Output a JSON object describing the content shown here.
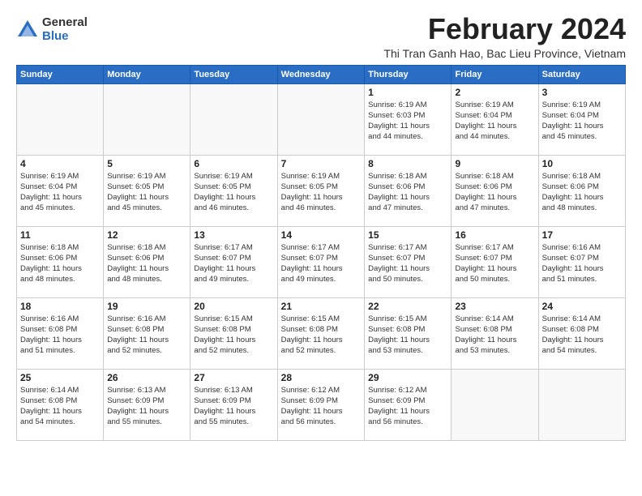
{
  "logo": {
    "general": "General",
    "blue": "Blue"
  },
  "title": "February 2024",
  "subtitle": "Thi Tran Ganh Hao, Bac Lieu Province, Vietnam",
  "headers": [
    "Sunday",
    "Monday",
    "Tuesday",
    "Wednesday",
    "Thursday",
    "Friday",
    "Saturday"
  ],
  "weeks": [
    [
      {
        "day": "",
        "info": ""
      },
      {
        "day": "",
        "info": ""
      },
      {
        "day": "",
        "info": ""
      },
      {
        "day": "",
        "info": ""
      },
      {
        "day": "1",
        "info": "Sunrise: 6:19 AM\nSunset: 6:03 PM\nDaylight: 11 hours\nand 44 minutes."
      },
      {
        "day": "2",
        "info": "Sunrise: 6:19 AM\nSunset: 6:04 PM\nDaylight: 11 hours\nand 44 minutes."
      },
      {
        "day": "3",
        "info": "Sunrise: 6:19 AM\nSunset: 6:04 PM\nDaylight: 11 hours\nand 45 minutes."
      }
    ],
    [
      {
        "day": "4",
        "info": "Sunrise: 6:19 AM\nSunset: 6:04 PM\nDaylight: 11 hours\nand 45 minutes."
      },
      {
        "day": "5",
        "info": "Sunrise: 6:19 AM\nSunset: 6:05 PM\nDaylight: 11 hours\nand 45 minutes."
      },
      {
        "day": "6",
        "info": "Sunrise: 6:19 AM\nSunset: 6:05 PM\nDaylight: 11 hours\nand 46 minutes."
      },
      {
        "day": "7",
        "info": "Sunrise: 6:19 AM\nSunset: 6:05 PM\nDaylight: 11 hours\nand 46 minutes."
      },
      {
        "day": "8",
        "info": "Sunrise: 6:18 AM\nSunset: 6:06 PM\nDaylight: 11 hours\nand 47 minutes."
      },
      {
        "day": "9",
        "info": "Sunrise: 6:18 AM\nSunset: 6:06 PM\nDaylight: 11 hours\nand 47 minutes."
      },
      {
        "day": "10",
        "info": "Sunrise: 6:18 AM\nSunset: 6:06 PM\nDaylight: 11 hours\nand 48 minutes."
      }
    ],
    [
      {
        "day": "11",
        "info": "Sunrise: 6:18 AM\nSunset: 6:06 PM\nDaylight: 11 hours\nand 48 minutes."
      },
      {
        "day": "12",
        "info": "Sunrise: 6:18 AM\nSunset: 6:06 PM\nDaylight: 11 hours\nand 48 minutes."
      },
      {
        "day": "13",
        "info": "Sunrise: 6:17 AM\nSunset: 6:07 PM\nDaylight: 11 hours\nand 49 minutes."
      },
      {
        "day": "14",
        "info": "Sunrise: 6:17 AM\nSunset: 6:07 PM\nDaylight: 11 hours\nand 49 minutes."
      },
      {
        "day": "15",
        "info": "Sunrise: 6:17 AM\nSunset: 6:07 PM\nDaylight: 11 hours\nand 50 minutes."
      },
      {
        "day": "16",
        "info": "Sunrise: 6:17 AM\nSunset: 6:07 PM\nDaylight: 11 hours\nand 50 minutes."
      },
      {
        "day": "17",
        "info": "Sunrise: 6:16 AM\nSunset: 6:07 PM\nDaylight: 11 hours\nand 51 minutes."
      }
    ],
    [
      {
        "day": "18",
        "info": "Sunrise: 6:16 AM\nSunset: 6:08 PM\nDaylight: 11 hours\nand 51 minutes."
      },
      {
        "day": "19",
        "info": "Sunrise: 6:16 AM\nSunset: 6:08 PM\nDaylight: 11 hours\nand 52 minutes."
      },
      {
        "day": "20",
        "info": "Sunrise: 6:15 AM\nSunset: 6:08 PM\nDaylight: 11 hours\nand 52 minutes."
      },
      {
        "day": "21",
        "info": "Sunrise: 6:15 AM\nSunset: 6:08 PM\nDaylight: 11 hours\nand 52 minutes."
      },
      {
        "day": "22",
        "info": "Sunrise: 6:15 AM\nSunset: 6:08 PM\nDaylight: 11 hours\nand 53 minutes."
      },
      {
        "day": "23",
        "info": "Sunrise: 6:14 AM\nSunset: 6:08 PM\nDaylight: 11 hours\nand 53 minutes."
      },
      {
        "day": "24",
        "info": "Sunrise: 6:14 AM\nSunset: 6:08 PM\nDaylight: 11 hours\nand 54 minutes."
      }
    ],
    [
      {
        "day": "25",
        "info": "Sunrise: 6:14 AM\nSunset: 6:08 PM\nDaylight: 11 hours\nand 54 minutes."
      },
      {
        "day": "26",
        "info": "Sunrise: 6:13 AM\nSunset: 6:09 PM\nDaylight: 11 hours\nand 55 minutes."
      },
      {
        "day": "27",
        "info": "Sunrise: 6:13 AM\nSunset: 6:09 PM\nDaylight: 11 hours\nand 55 minutes."
      },
      {
        "day": "28",
        "info": "Sunrise: 6:12 AM\nSunset: 6:09 PM\nDaylight: 11 hours\nand 56 minutes."
      },
      {
        "day": "29",
        "info": "Sunrise: 6:12 AM\nSunset: 6:09 PM\nDaylight: 11 hours\nand 56 minutes."
      },
      {
        "day": "",
        "info": ""
      },
      {
        "day": "",
        "info": ""
      }
    ]
  ]
}
